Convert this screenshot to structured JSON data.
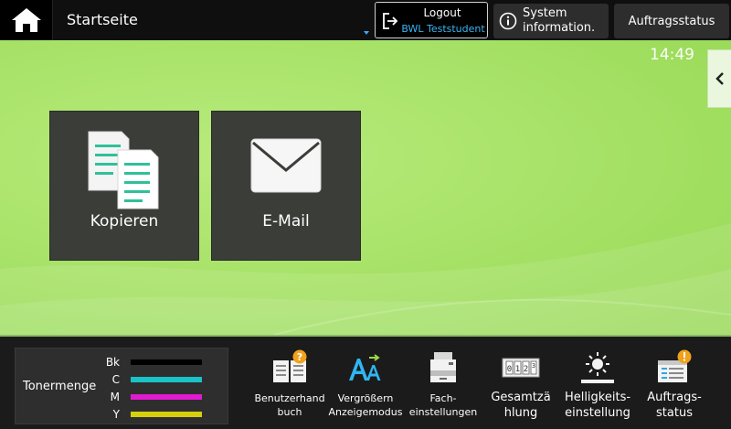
{
  "header": {
    "title": "Startseite",
    "logout_label": "Logout",
    "logout_user": "BWL Teststudent",
    "sysinfo_label": "System\ninformation.",
    "jobstatus_label": "Auftragsstatus"
  },
  "main": {
    "clock": "14:49",
    "tiles": [
      {
        "label": "Kopieren",
        "icon": "copy-icon"
      },
      {
        "label": "E-Mail",
        "icon": "envelope-icon"
      }
    ]
  },
  "toner": {
    "title": "Tonermenge",
    "levels": [
      {
        "label": "Bk",
        "color": "#000000"
      },
      {
        "label": "C",
        "color": "#19c3c8"
      },
      {
        "label": "M",
        "color": "#e01ad0"
      },
      {
        "label": "Y",
        "color": "#d6cf0c"
      }
    ]
  },
  "functions": [
    {
      "label": "Benutzerhand\nbuch",
      "icon": "manual-icon"
    },
    {
      "label": "Vergrößern\nAnzeigemodus",
      "icon": "enlarge-text-icon"
    },
    {
      "label": "Fach-\neinstellungen",
      "icon": "tray-settings-icon"
    },
    {
      "label": "Gesamtzä\nhlung",
      "icon": "counter-icon"
    },
    {
      "label": "Helligkeits-\neinstellung",
      "icon": "brightness-icon"
    },
    {
      "label": "Auftrags-\nstatus",
      "icon": "job-status-icon"
    }
  ],
  "colors": {
    "background_green": "#a9e36a",
    "topbar": "#0f0f0f",
    "tile": "#3a3d38",
    "accent_blue": "#3ab4f2"
  }
}
